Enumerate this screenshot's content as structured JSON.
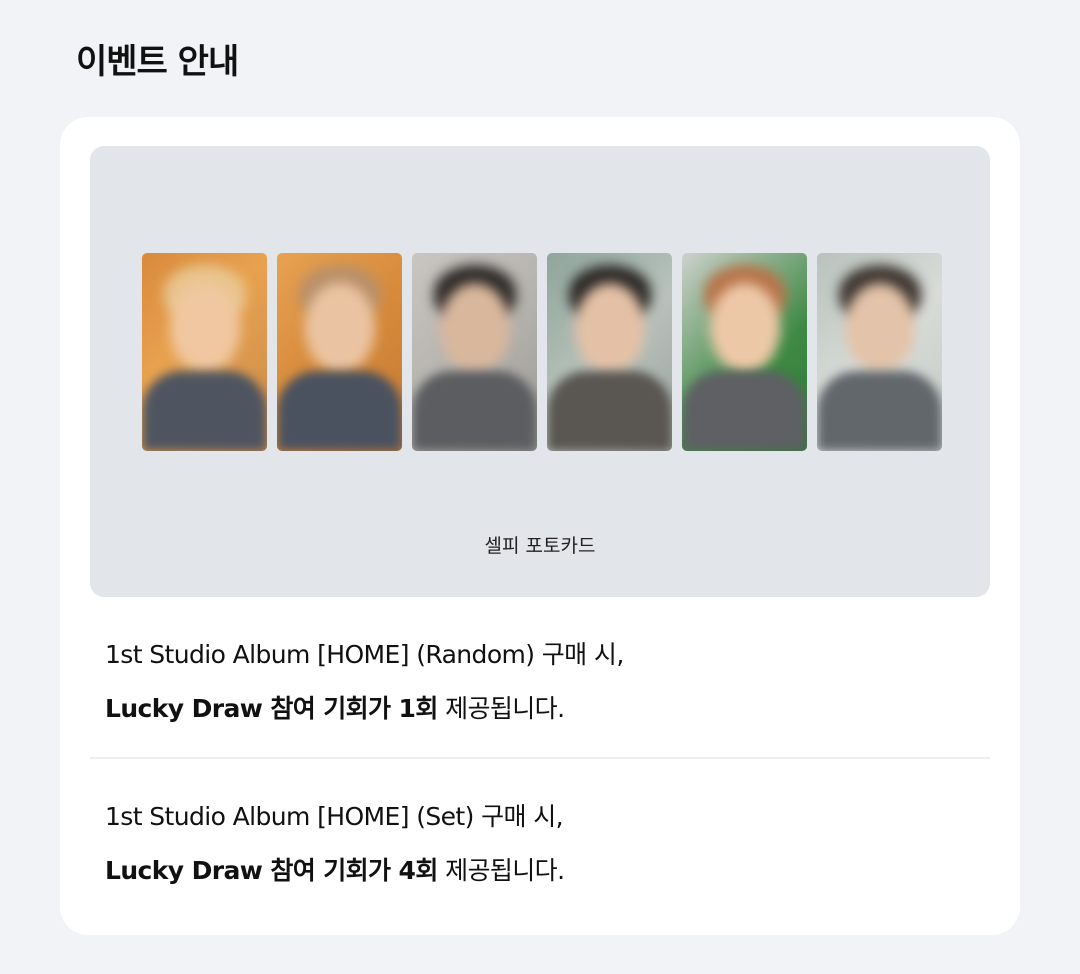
{
  "page": {
    "title": "이벤트 안내"
  },
  "event_card": {
    "media": {
      "caption": "셀피 포토카드",
      "photocards": [
        {
          "name": "photocard-1"
        },
        {
          "name": "photocard-2"
        },
        {
          "name": "photocard-3"
        },
        {
          "name": "photocard-4"
        },
        {
          "name": "photocard-5"
        },
        {
          "name": "photocard-6"
        }
      ]
    },
    "offers": [
      {
        "condition": "1st Studio Album [HOME] (Random) 구매 시,",
        "highlight": "Lucky Draw 참여 기회가 1회",
        "suffix": " 제공됩니다."
      },
      {
        "condition": "1st Studio Album [HOME] (Set) 구매 시,",
        "highlight": "Lucky Draw 참여 기회가 4회",
        "suffix": " 제공됩니다."
      }
    ]
  },
  "colors": {
    "page_background": "#f1f3f7",
    "card_background": "#ffffff",
    "media_background": "#e2e5ea",
    "divider": "#eceef1"
  }
}
